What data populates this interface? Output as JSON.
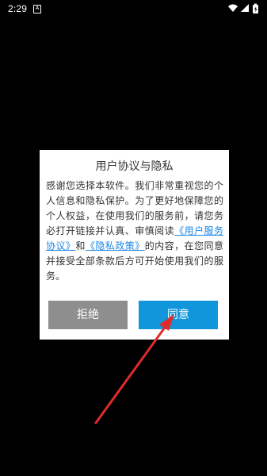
{
  "status_bar": {
    "time": "2:29",
    "notification_icon": "a-icon",
    "wifi_icon": "wifi-icon",
    "signal_icon": "signal-icon",
    "battery_icon": "battery-charging-icon"
  },
  "dialog": {
    "title": "用户协议与隐私",
    "body_part1": "感谢您选择本软件。我们非常重视您的个人信息和隐私保护。为了更好地保障您的个人权益，在使用我们的服务前，请您务必打开链接并认真、审慎阅读",
    "user_agreement_link": "《用户服务协议》",
    "and_text": "和",
    "privacy_policy_link": "《隐私政策》",
    "body_part2": "的内容，在您同意并接受全部条款后方可开始使用我们的服务。",
    "refuse_label": "拒绝",
    "agree_label": "同意"
  },
  "colors": {
    "background": "#000000",
    "dialog_bg": "#ffffff",
    "link": "#1e88e5",
    "refuse_button": "#8e8e8e",
    "agree_button": "#1296db",
    "arrow": "#e02b2b"
  },
  "annotation": {
    "arrow_icon": "red-arrow-icon"
  }
}
